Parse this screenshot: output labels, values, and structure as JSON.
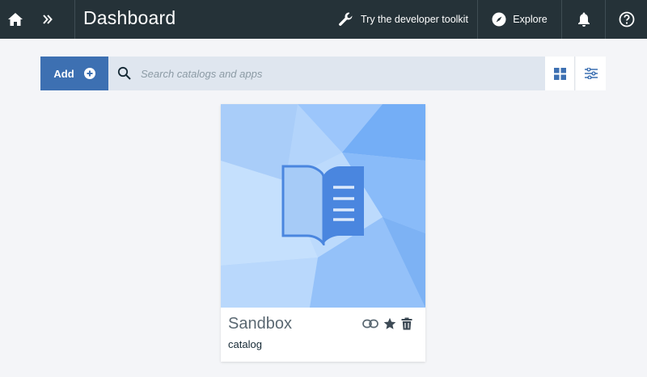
{
  "header": {
    "title": "Dashboard",
    "toolkit_label": "Try the developer toolkit",
    "explore_label": "Explore",
    "icons": [
      "home-icon",
      "double-chevron-icon",
      "wrench-icon",
      "compass-icon",
      "bell-icon",
      "help-icon"
    ]
  },
  "toolbar": {
    "add_label": "Add",
    "search_placeholder": "Search catalogs and apps"
  },
  "cards": [
    {
      "name": "Sandbox",
      "type": "catalog"
    }
  ],
  "colors": {
    "header_bg": "#253238",
    "accent": "#3d70b2",
    "search_bg": "#dfe6ef",
    "page_bg": "#f4f5f8"
  }
}
